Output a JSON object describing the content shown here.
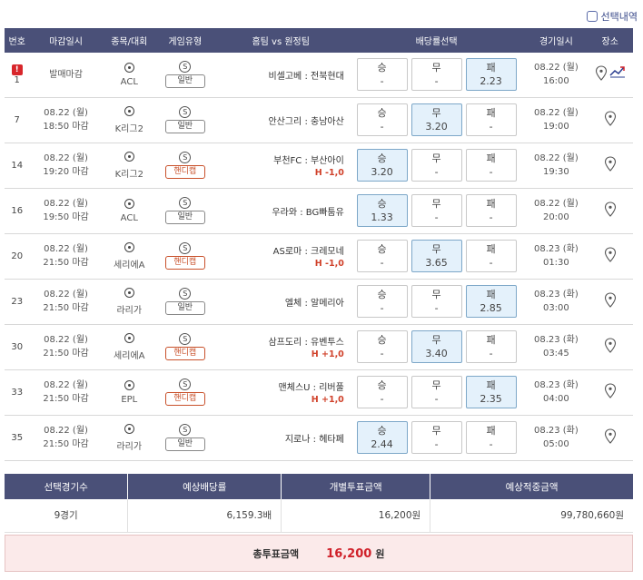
{
  "header_check": {
    "label": "선택내역"
  },
  "columns": [
    "번호",
    "마감일시",
    "종목/대회",
    "게임유형",
    "홈팀 vs 원정팀",
    "배당률선택",
    "경기일시",
    "장소"
  ],
  "games": [
    {
      "no": "1",
      "alert": "!",
      "deadline_date": "",
      "deadline_time": "발매마감",
      "league": "ACL",
      "type_badge": "S",
      "type": "일반",
      "handicap": false,
      "hcap_text": "",
      "home": "비셀고베",
      "away": "전북현대",
      "odds": [
        {
          "label": "승",
          "value": "-",
          "sel": false
        },
        {
          "label": "무",
          "value": "-",
          "sel": false
        },
        {
          "label": "패",
          "value": "2.23",
          "sel": true
        }
      ],
      "game_date": "08.22 (월)",
      "game_time": "16:00",
      "extra_icon": true
    },
    {
      "no": "7",
      "alert": "",
      "deadline_date": "08.22 (월)",
      "deadline_time": "18:50 마감",
      "league": "K리그2",
      "type_badge": "S",
      "type": "일반",
      "handicap": false,
      "hcap_text": "",
      "home": "안산그리",
      "away": "충남아산",
      "odds": [
        {
          "label": "승",
          "value": "-",
          "sel": false
        },
        {
          "label": "무",
          "value": "3.20",
          "sel": true
        },
        {
          "label": "패",
          "value": "-",
          "sel": false
        }
      ],
      "game_date": "08.22 (월)",
      "game_time": "19:00",
      "extra_icon": false
    },
    {
      "no": "14",
      "alert": "",
      "deadline_date": "08.22 (월)",
      "deadline_time": "19:20 마감",
      "league": "K리그2",
      "type_badge": "S",
      "type": "핸디캡",
      "handicap": true,
      "hcap_text": "H -1,0",
      "home": "부천FC",
      "away": "부산아이",
      "odds": [
        {
          "label": "승",
          "value": "3.20",
          "sel": true
        },
        {
          "label": "무",
          "value": "-",
          "sel": false
        },
        {
          "label": "패",
          "value": "-",
          "sel": false
        }
      ],
      "game_date": "08.22 (월)",
      "game_time": "19:30",
      "extra_icon": false
    },
    {
      "no": "16",
      "alert": "",
      "deadline_date": "08.22 (월)",
      "deadline_time": "19:50 마감",
      "league": "ACL",
      "type_badge": "S",
      "type": "일반",
      "handicap": false,
      "hcap_text": "",
      "home": "우라와",
      "away": "BG빠툼유",
      "odds": [
        {
          "label": "승",
          "value": "1.33",
          "sel": true
        },
        {
          "label": "무",
          "value": "-",
          "sel": false
        },
        {
          "label": "패",
          "value": "-",
          "sel": false
        }
      ],
      "game_date": "08.22 (월)",
      "game_time": "20:00",
      "extra_icon": false
    },
    {
      "no": "20",
      "alert": "",
      "deadline_date": "08.22 (월)",
      "deadline_time": "21:50 마감",
      "league": "세리에A",
      "type_badge": "S",
      "type": "핸디캡",
      "handicap": true,
      "hcap_text": "H -1,0",
      "home": "AS로마",
      "away": "크레모네",
      "odds": [
        {
          "label": "승",
          "value": "-",
          "sel": false
        },
        {
          "label": "무",
          "value": "3.65",
          "sel": true
        },
        {
          "label": "패",
          "value": "-",
          "sel": false
        }
      ],
      "game_date": "08.23 (화)",
      "game_time": "01:30",
      "extra_icon": false
    },
    {
      "no": "23",
      "alert": "",
      "deadline_date": "08.22 (월)",
      "deadline_time": "21:50 마감",
      "league": "라리가",
      "type_badge": "S",
      "type": "일반",
      "handicap": false,
      "hcap_text": "",
      "home": "엘체",
      "away": "알메리아",
      "odds": [
        {
          "label": "승",
          "value": "-",
          "sel": false
        },
        {
          "label": "무",
          "value": "-",
          "sel": false
        },
        {
          "label": "패",
          "value": "2.85",
          "sel": true
        }
      ],
      "game_date": "08.23 (화)",
      "game_time": "03:00",
      "extra_icon": false
    },
    {
      "no": "30",
      "alert": "",
      "deadline_date": "08.22 (월)",
      "deadline_time": "21:50 마감",
      "league": "세리에A",
      "type_badge": "S",
      "type": "핸디캡",
      "handicap": true,
      "hcap_text": "H +1,0",
      "home": "삼프도리",
      "away": "유벤투스",
      "odds": [
        {
          "label": "승",
          "value": "-",
          "sel": false
        },
        {
          "label": "무",
          "value": "3.40",
          "sel": true
        },
        {
          "label": "패",
          "value": "-",
          "sel": false
        }
      ],
      "game_date": "08.23 (화)",
      "game_time": "03:45",
      "extra_icon": false
    },
    {
      "no": "33",
      "alert": "",
      "deadline_date": "08.22 (월)",
      "deadline_time": "21:50 마감",
      "league": "EPL",
      "type_badge": "S",
      "type": "핸디캡",
      "handicap": true,
      "hcap_text": "H +1,0",
      "home": "맨체스U",
      "away": "리버풀",
      "odds": [
        {
          "label": "승",
          "value": "-",
          "sel": false
        },
        {
          "label": "무",
          "value": "-",
          "sel": false
        },
        {
          "label": "패",
          "value": "2.35",
          "sel": true
        }
      ],
      "game_date": "08.23 (화)",
      "game_time": "04:00",
      "extra_icon": false
    },
    {
      "no": "35",
      "alert": "",
      "deadline_date": "08.22 (월)",
      "deadline_time": "21:50 마감",
      "league": "라리가",
      "type_badge": "S",
      "type": "일반",
      "handicap": false,
      "hcap_text": "",
      "home": "지로나",
      "away": "헤타페",
      "odds": [
        {
          "label": "승",
          "value": "2.44",
          "sel": true
        },
        {
          "label": "무",
          "value": "-",
          "sel": false
        },
        {
          "label": "패",
          "value": "-",
          "sel": false
        }
      ],
      "game_date": "08.23 (화)",
      "game_time": "05:00",
      "extra_icon": false
    }
  ],
  "summary": {
    "headers": [
      "선택경기수",
      "예상배당률",
      "개별투표금액",
      "예상적중금액"
    ],
    "values": [
      "9경기",
      "6,159.3배",
      "16,200원",
      "99,780,660원"
    ]
  },
  "total": {
    "label": "총투표금액",
    "amount": "16,200",
    "unit": "원"
  },
  "colors": {
    "header_bg": "#4a5078",
    "selected_bg": "#e4f1fb",
    "handicap": "#d0412a",
    "total_bg": "#fbeaea"
  }
}
